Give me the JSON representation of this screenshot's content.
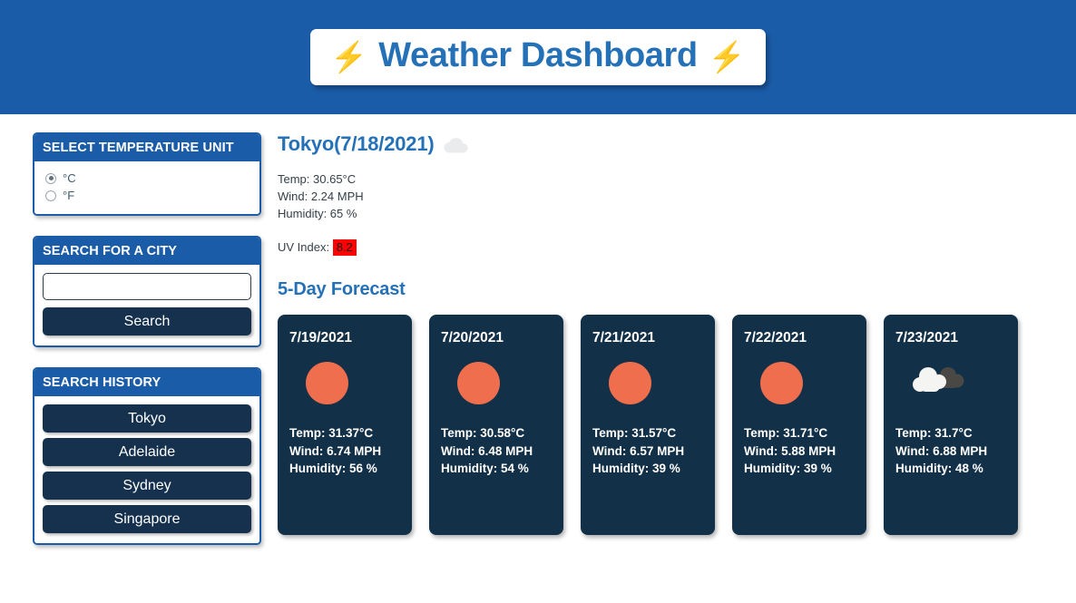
{
  "header": {
    "title": "Weather Dashboard",
    "bolt_icon": "lightning-bolt-icon",
    "bolt_glyph": "⚡"
  },
  "sidebar": {
    "unit_panel": {
      "heading": "SELECT TEMPERATURE UNIT",
      "options": [
        {
          "label": "°C",
          "selected": true
        },
        {
          "label": "°F",
          "selected": false
        }
      ]
    },
    "search_panel": {
      "heading": "SEARCH FOR A CITY",
      "input_value": "",
      "input_placeholder": "",
      "button_label": "Search"
    },
    "history_panel": {
      "heading": "SEARCH HISTORY",
      "items": [
        "Tokyo",
        "Adelaide",
        "Sydney",
        "Singapore"
      ]
    }
  },
  "current": {
    "city_date": "Tokyo(7/18/2021)",
    "icon": "cloud-icon",
    "temp": "Temp: 30.65°C",
    "wind": "Wind: 2.24 MPH",
    "humidity": "Humidity: 65 %",
    "uv_label": "UV Index:",
    "uv_value": "8.2",
    "uv_color": "#ff0000"
  },
  "forecast": {
    "heading": "5-Day Forecast",
    "cards": [
      {
        "date": "7/19/2021",
        "icon": "sun-icon",
        "temp": "Temp: 31.37°C",
        "wind": "Wind: 6.74 MPH",
        "humidity": "Humidity: 56 %"
      },
      {
        "date": "7/20/2021",
        "icon": "sun-icon",
        "temp": "Temp: 30.58°C",
        "wind": "Wind: 6.48 MPH",
        "humidity": "Humidity: 54 %"
      },
      {
        "date": "7/21/2021",
        "icon": "sun-icon",
        "temp": "Temp: 31.57°C",
        "wind": "Wind: 6.57 MPH",
        "humidity": "Humidity: 39 %"
      },
      {
        "date": "7/22/2021",
        "icon": "sun-icon",
        "temp": "Temp: 31.71°C",
        "wind": "Wind: 5.88 MPH",
        "humidity": "Humidity: 39 %"
      },
      {
        "date": "7/23/2021",
        "icon": "broken-clouds-icon",
        "temp": "Temp: 31.7°C",
        "wind": "Wind: 6.88 MPH",
        "humidity": "Humidity: 48 %"
      }
    ]
  },
  "colors": {
    "banner_blue": "#1a5ca8",
    "title_blue": "#2571b7",
    "card_navy": "#123047",
    "button_navy": "#15314d",
    "sun_orange": "#ee6e4e",
    "uv_red": "#ff0000"
  }
}
